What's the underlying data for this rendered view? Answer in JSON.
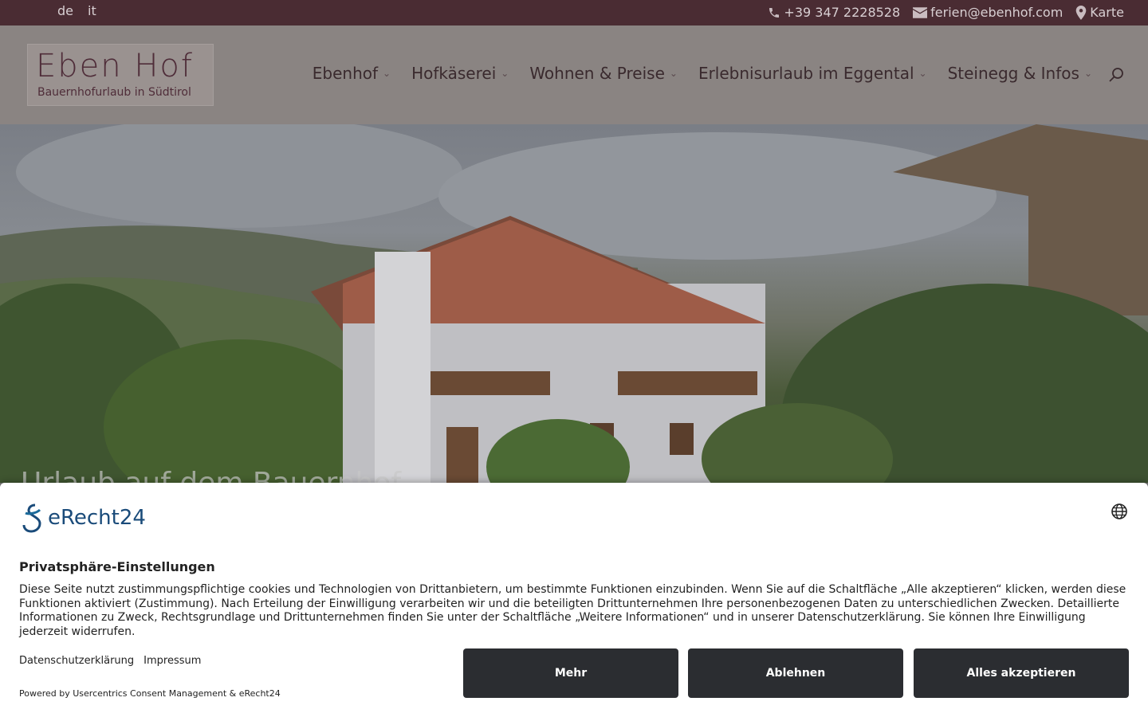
{
  "topbar": {
    "langs": [
      "de",
      "it"
    ],
    "phone": "+39 347 2228528",
    "email": "ferien@ebenhof.com",
    "map": "Karte"
  },
  "logo": {
    "title": "Eben Hof",
    "subtitle": "Bauernhofurlaub in Südtirol"
  },
  "nav": {
    "items": [
      {
        "label": "Ebenhof"
      },
      {
        "label": "Hofkäserei"
      },
      {
        "label": "Wohnen & Preise"
      },
      {
        "label": "Erlebnisurlaub im Eggental"
      },
      {
        "label": "Steinegg & Infos"
      }
    ]
  },
  "hero": {
    "title": "Urlaub auf dem Bauernhof"
  },
  "consent": {
    "brand": "eRecht24",
    "title": "Privatsphäre-Einstellungen",
    "text": "Diese Seite nutzt zustimmungspflichtige cookies und Technologien von Drittanbietern, um bestimmte Funktionen einzubinden. Wenn Sie auf die Schaltfläche „Alle akzeptieren“ klicken, werden diese Funktionen aktiviert (Zustimmung). Nach Erteilung der Einwilligung verarbeiten wir und die beteiligten Drittunternehmen Ihre personenbezogenen Daten zu unterschiedlichen Zwecken. Detaillierte Informationen zu Zweck, Rechtsgrundlage und Drittunternehmen finden Sie unter der Schaltfläche „Weitere Informationen“ und in unserer Datenschutzerklärung. Sie können Ihre Einwilligung jederzeit widerrufen.",
    "link_privacy": "Datenschutzerklärung",
    "link_imprint": "Impressum",
    "powered": "Powered by Usercentrics Consent Management & eRecht24",
    "btn_more": "Mehr",
    "btn_decline": "Ablehnen",
    "btn_accept": "Alles akzeptieren"
  },
  "colors": {
    "topbar": "#4a2c33",
    "brand": "#4f2d39",
    "button": "#2b2d31"
  }
}
